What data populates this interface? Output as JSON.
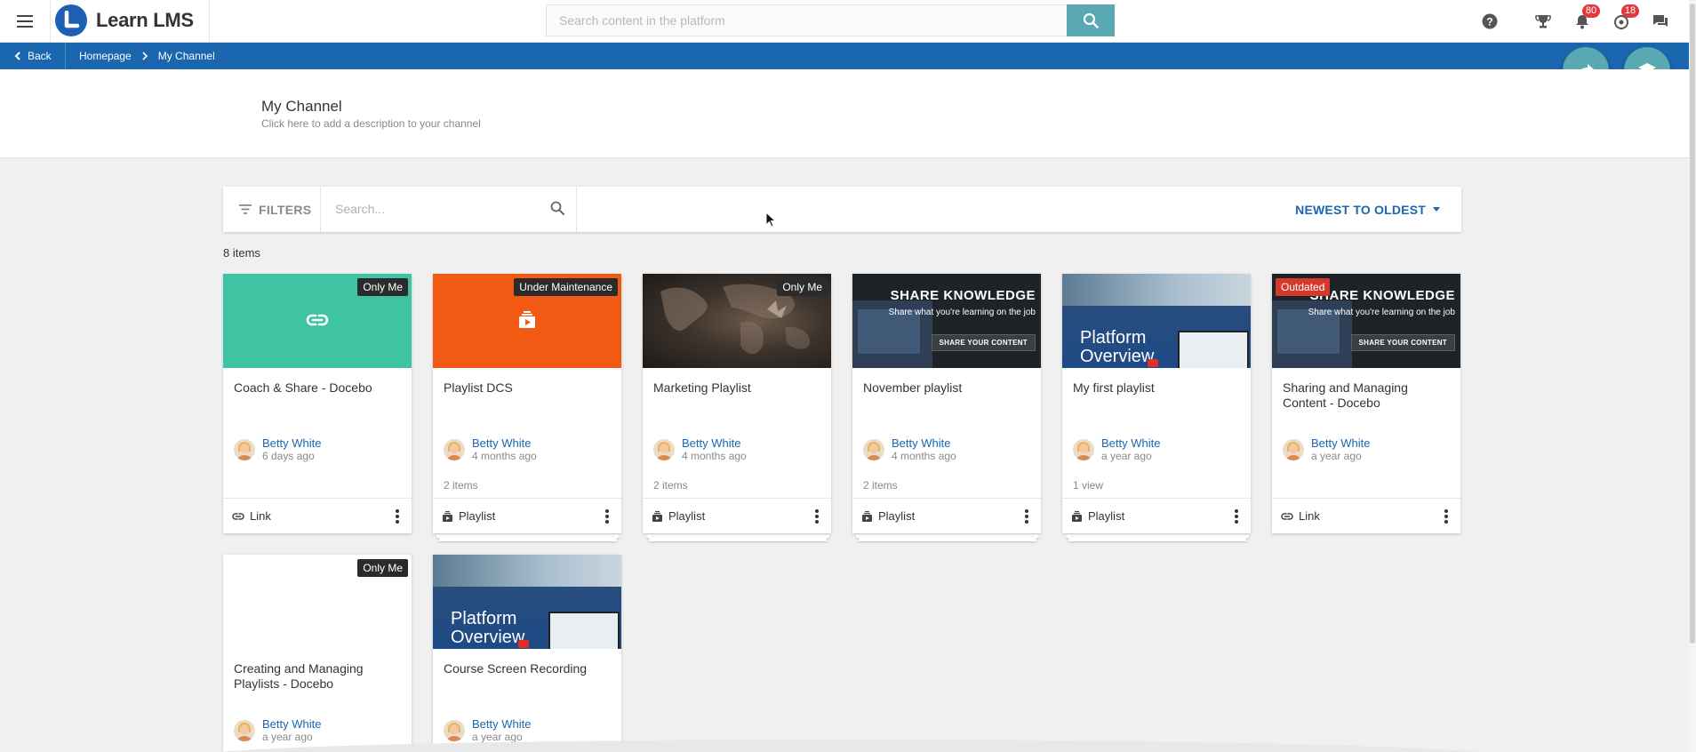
{
  "app": {
    "name": "Learn LMS",
    "brand_color": "#1a67b0",
    "accent_color": "#5aa8b1"
  },
  "header": {
    "search_placeholder": "Search content in the platform",
    "notifications_count": "80",
    "messages_count": "18"
  },
  "breadcrumb": {
    "back_label": "Back",
    "items": [
      "Homepage",
      "My Channel"
    ]
  },
  "channel": {
    "title": "My Channel",
    "description": "Click here to add a description to your channel"
  },
  "toolbar": {
    "filters_label": "FILTERS",
    "search_placeholder": "Search...",
    "sort_label": "NEWEST TO OLDEST"
  },
  "items_count": "8 items",
  "cards": [
    {
      "title": "Coach & Share - Docebo",
      "author": "Betty White",
      "time": "6 days ago",
      "meta": "",
      "type": "Link",
      "tag": "Only Me"
    },
    {
      "title": "Playlist DCS",
      "author": "Betty White",
      "time": "4 months ago",
      "meta": "2 items",
      "type": "Playlist",
      "tag": "Under Maintenance"
    },
    {
      "title": "Marketing Playlist",
      "author": "Betty White",
      "time": "4 months ago",
      "meta": "2 items",
      "type": "Playlist",
      "tag": "Only Me"
    },
    {
      "title": "November playlist",
      "author": "Betty White",
      "time": "4 months ago",
      "meta": "2 items",
      "type": "Playlist",
      "tag": "",
      "thumb_heading": "SHARE KNOWLEDGE",
      "thumb_sub": "Share what you're learning on the job",
      "thumb_button": "SHARE YOUR CONTENT"
    },
    {
      "title": "My first playlist",
      "author": "Betty White",
      "time": "a year ago",
      "meta": "1 view",
      "type": "Playlist",
      "tag": "",
      "thumb_line1": "Platform",
      "thumb_line2": "Overview"
    },
    {
      "title": "Sharing and Managing Content - Docebo",
      "author": "Betty White",
      "time": "a year ago",
      "meta": "",
      "type": "Link",
      "tag": "Outdated",
      "thumb_heading": "SHARE KNOWLEDGE",
      "thumb_sub": "Share what you're learning on the job",
      "thumb_button": "SHARE YOUR CONTENT"
    },
    {
      "title": "Creating and Managing Playlists - Docebo",
      "author": "Betty White",
      "time": "a year ago",
      "meta": "",
      "type": "",
      "tag": "Only Me"
    },
    {
      "title": "Course Screen Recording",
      "author": "Betty White",
      "time": "a year ago",
      "meta": "",
      "type": "",
      "tag": "",
      "thumb_line1": "Platform",
      "thumb_line2": "Overview"
    }
  ]
}
